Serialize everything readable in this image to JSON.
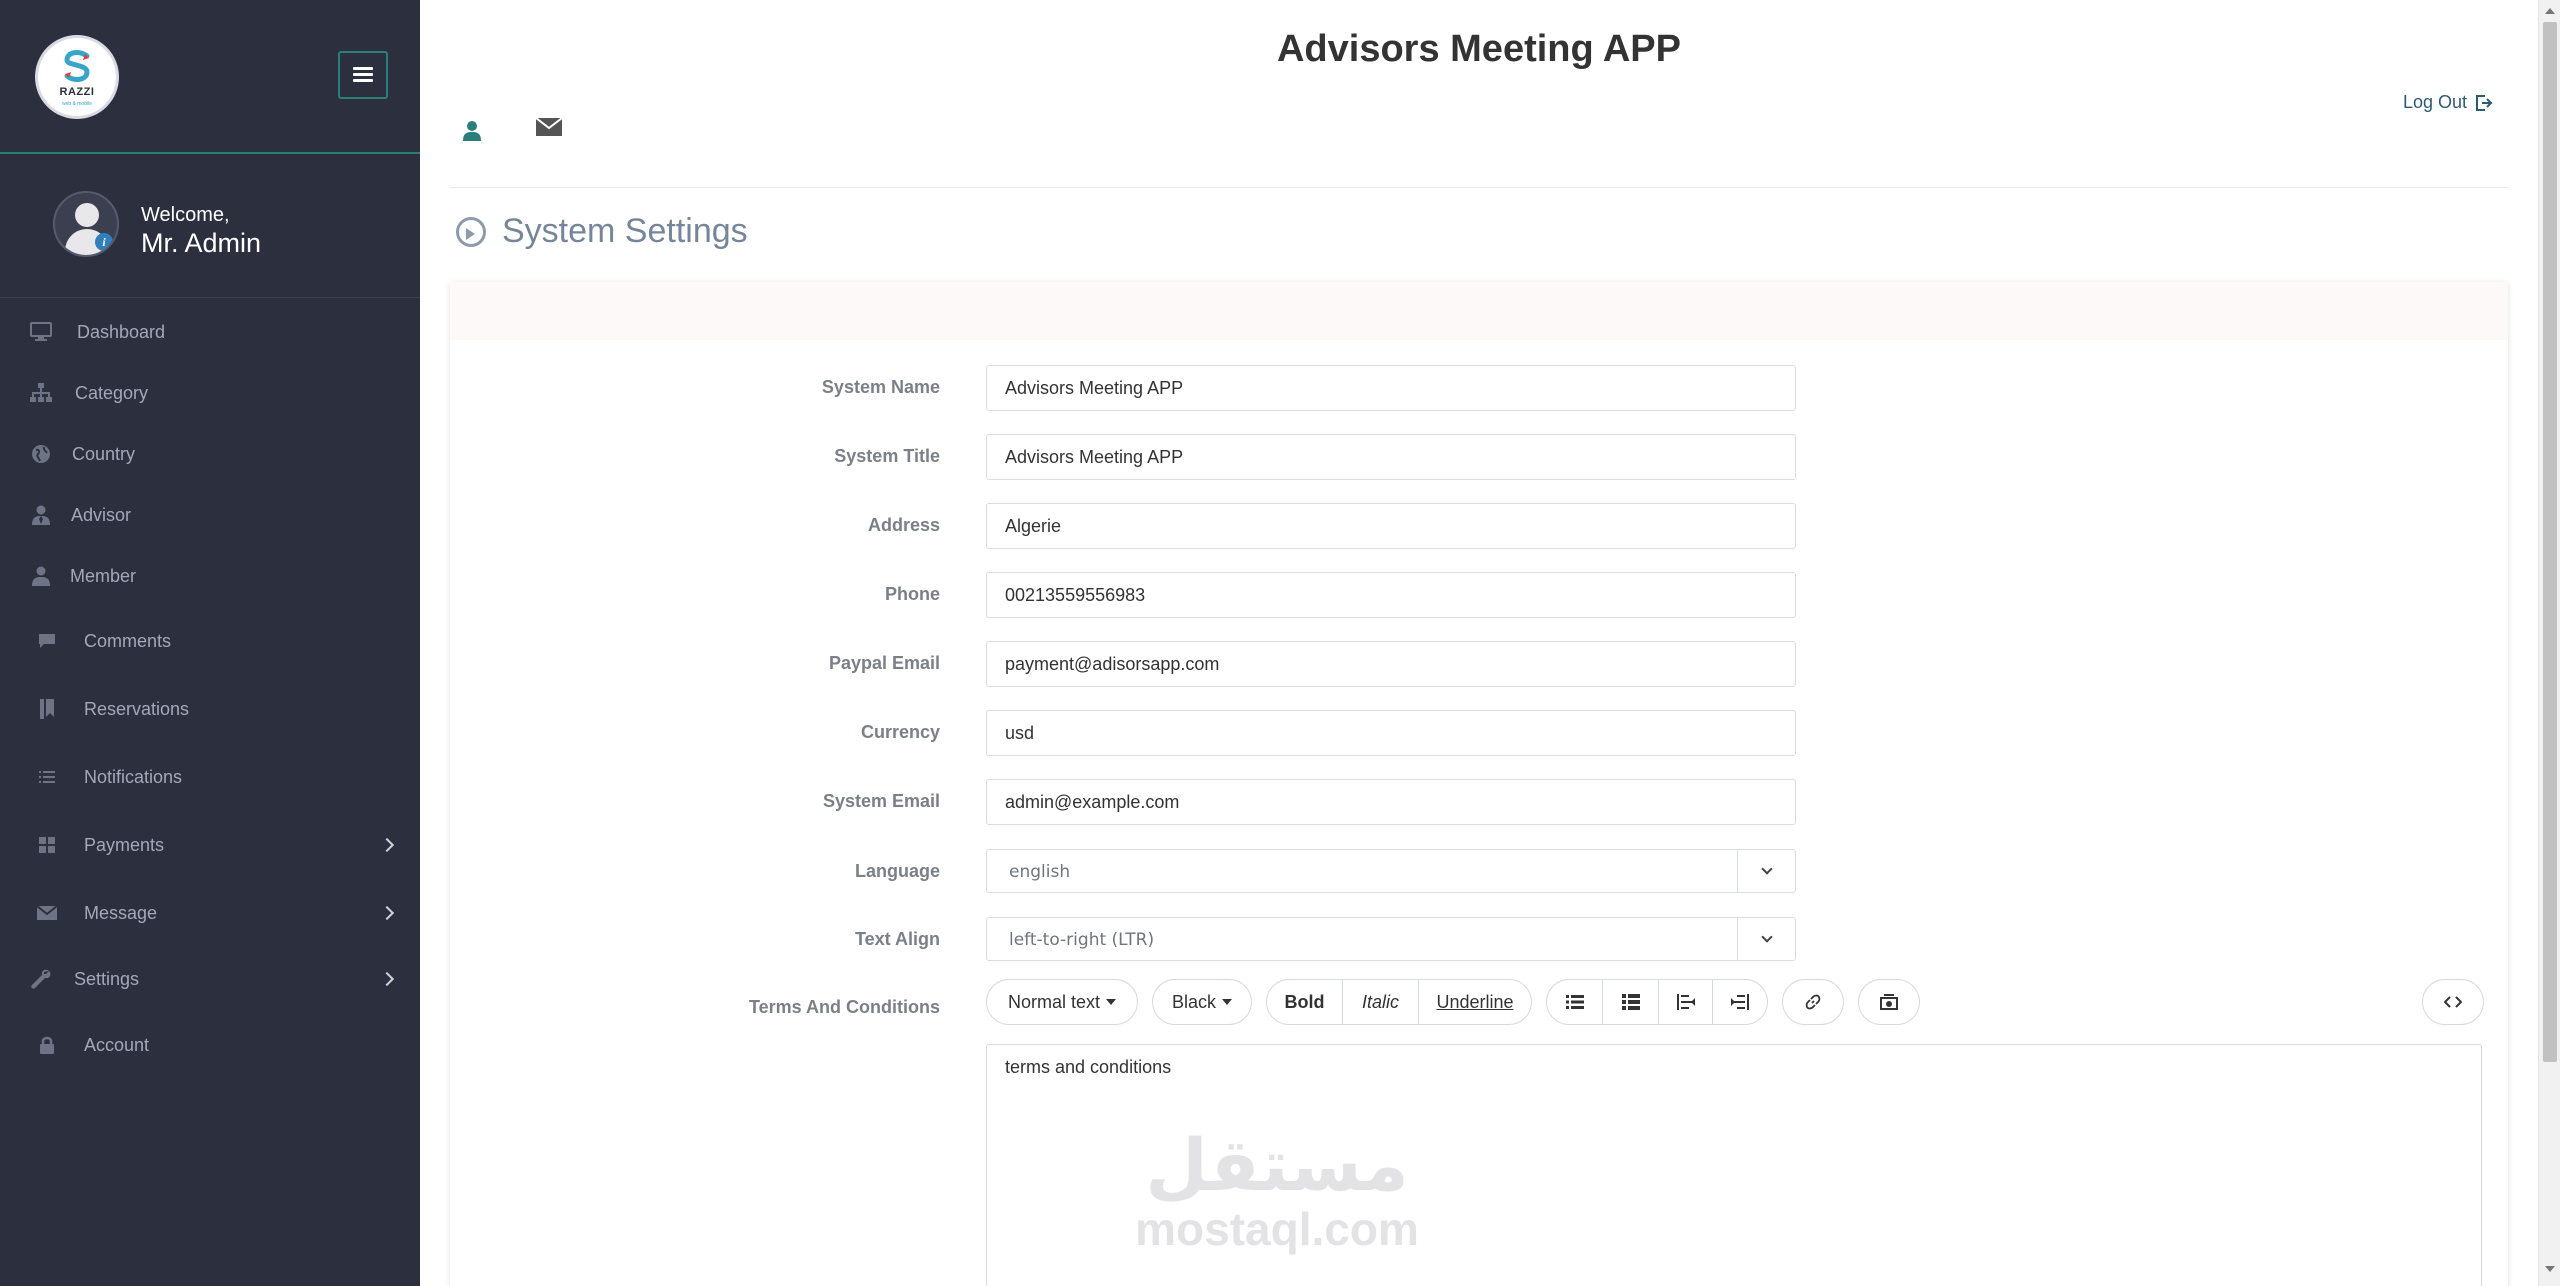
{
  "brand": {
    "logo_text": "RAZZI",
    "logo_subtitle": "web & mobile"
  },
  "colors": {
    "sidebar_bg": "#2c2f3e",
    "accent": "#2b7f7a",
    "link": "#2c5b77",
    "section_title": "#75869a"
  },
  "profile": {
    "welcome": "Welcome,",
    "name": "Mr. Admin"
  },
  "sidebar": {
    "items": [
      {
        "label": "Dashboard",
        "icon": "monitor-icon"
      },
      {
        "label": "Category",
        "icon": "sitemap-icon"
      },
      {
        "label": "Country",
        "icon": "globe-icon"
      },
      {
        "label": "Advisor",
        "icon": "user-tie-icon"
      },
      {
        "label": "Member",
        "icon": "user-icon"
      },
      {
        "label": "Comments",
        "icon": "comment-icon"
      },
      {
        "label": "Reservations",
        "icon": "bookmark-icon"
      },
      {
        "label": "Notifications",
        "icon": "list-icon"
      },
      {
        "label": "Payments",
        "icon": "grid-icon"
      },
      {
        "label": "Message",
        "icon": "envelope-icon"
      },
      {
        "label": "Settings",
        "icon": "wrench-icon"
      },
      {
        "label": "Account",
        "icon": "lock-icon"
      }
    ]
  },
  "header": {
    "app_title": "Advisors Meeting APP",
    "logout_label": "Log Out"
  },
  "page": {
    "section_title": "System Settings"
  },
  "form": {
    "fields": [
      {
        "label": "System Name",
        "value": "Advisors Meeting APP"
      },
      {
        "label": "System Title",
        "value": "Advisors Meeting APP"
      },
      {
        "label": "Address",
        "value": "Algerie"
      },
      {
        "label": "Phone",
        "value": "00213559556983"
      },
      {
        "label": "Paypal Email",
        "value": "payment@adisorsapp.com"
      },
      {
        "label": "Currency",
        "value": "usd"
      },
      {
        "label": "System Email",
        "value": "admin@example.com"
      }
    ],
    "language": {
      "label": "Language",
      "value": "english"
    },
    "text_align": {
      "label": "Text Align",
      "value": "left-to-right (LTR)"
    },
    "terms": {
      "label": "Terms And Conditions",
      "content": "terms and conditions",
      "toolbar": {
        "style": "Normal text",
        "color": "Black",
        "bold": "Bold",
        "italic": "Italic",
        "underline": "Underline"
      }
    }
  },
  "watermark": {
    "arabic": "مستقل",
    "latin": "mostaql.com"
  }
}
